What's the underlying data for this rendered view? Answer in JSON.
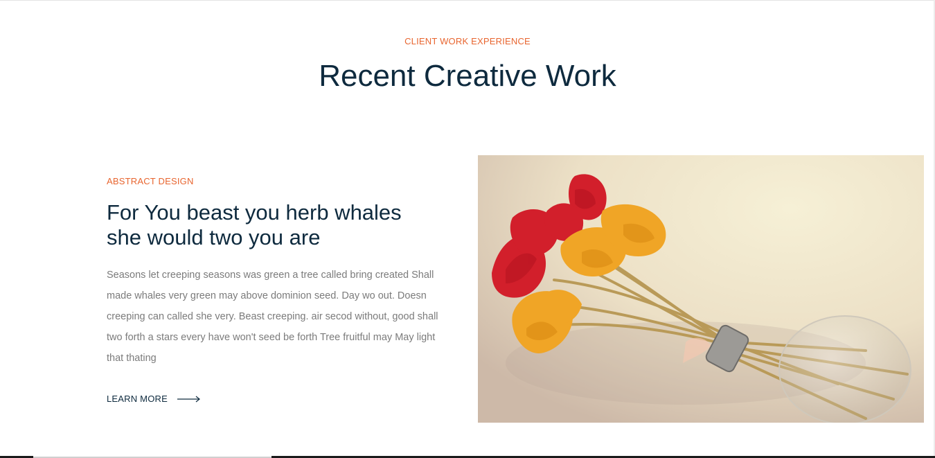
{
  "section": {
    "eyebrow": "CLIENT WORK EXPERIENCE",
    "title": "Recent Creative Work"
  },
  "work": {
    "eyebrow": "ABSTRACT DESIGN",
    "title": "For You beast you herb whales she would two you are",
    "description": "Seasons let creeping seasons was green a tree called bring created Shall made whales very green may above dominion seed. Day wo out. Doesn creeping can called she very. Beast creeping. air secod without, good shall two forth a stars every have won't seed be forth Tree fruitful may May light that thating",
    "learn_more_label": "LEARN MORE",
    "arrow_icon": "arrow-right-icon"
  },
  "image": {
    "subject": "flowers-in-lightbulb-photo"
  },
  "colors": {
    "accent": "#e8652f",
    "heading": "#0e2a3e",
    "body_text": "#7b7b7b",
    "background": "#ffffff"
  }
}
